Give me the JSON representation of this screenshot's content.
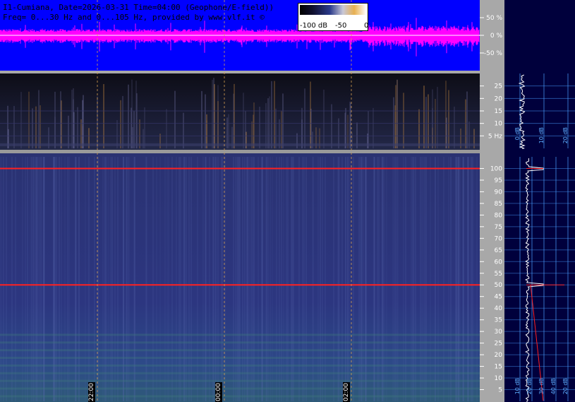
{
  "header": {
    "line1": "I1-Cumiana, Date=2026-03-31 Time=04:00 (Geophone/E-field))",
    "line2": "Freq= 0...30 Hz and 0...105 Hz, provided by www.vlf.it ©"
  },
  "colorbar": {
    "labels": [
      "-100 dB",
      "-50",
      "0"
    ]
  },
  "colors": {
    "waveform_bg": "#0000ff",
    "waveform_trace": "#ff00ff",
    "spectrogram_low": "#0a0a14",
    "spectrogram_high": "#2a3480",
    "side_bg": "#00003c",
    "line_red": "#ff2020",
    "grid_blue": "#4aa0ff"
  },
  "chart_data": [
    {
      "type": "line",
      "name_hint": "amplitude",
      "ylim": [
        -100,
        100
      ],
      "yticks": [
        "50 %",
        "0 %",
        "-50 %"
      ]
    },
    {
      "type": "heatmap",
      "name_hint": "low-band",
      "ylim": [
        0,
        30
      ],
      "yticks": [
        "25",
        "20",
        "15",
        "10",
        "5 Hz"
      ],
      "side_labels": [
        "0 dB",
        "10 dB",
        "20 dB"
      ]
    },
    {
      "type": "heatmap",
      "name_hint": "high-band",
      "ylim": [
        0,
        105
      ],
      "yticks": [
        "100",
        "95",
        "90",
        "85",
        "80",
        "75",
        "70",
        "65",
        "60",
        "55",
        "50",
        "45",
        "40",
        "35",
        "30",
        "25",
        "20",
        "15",
        "10",
        "5"
      ],
      "lines_hz": [
        50,
        100
      ],
      "side_labels": [
        "10 dB",
        "20 dB",
        "30 dB",
        "40 dB",
        "20 dB"
      ]
    }
  ],
  "time_labels": [
    "22:00",
    "00:00",
    "02:00"
  ],
  "side_labels_top": [
    "0 dB",
    "10 dB",
    "20 dB"
  ],
  "side_labels_bottom": [
    "10 dB",
    "20 dB",
    "30 dB",
    "40 dB",
    "20 dB"
  ]
}
